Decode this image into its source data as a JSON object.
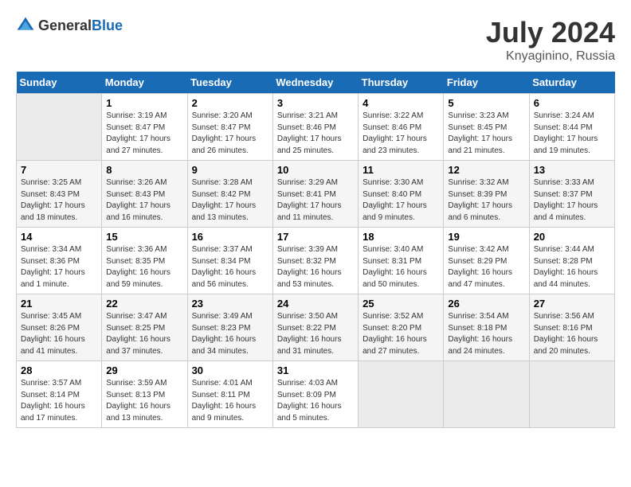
{
  "header": {
    "logo_general": "General",
    "logo_blue": "Blue",
    "month": "July 2024",
    "location": "Knyaginino, Russia"
  },
  "days_of_week": [
    "Sunday",
    "Monday",
    "Tuesday",
    "Wednesday",
    "Thursday",
    "Friday",
    "Saturday"
  ],
  "weeks": [
    [
      {
        "day": "",
        "sunrise": "",
        "sunset": "",
        "daylight": ""
      },
      {
        "day": "1",
        "sunrise": "Sunrise: 3:19 AM",
        "sunset": "Sunset: 8:47 PM",
        "daylight": "Daylight: 17 hours and 27 minutes."
      },
      {
        "day": "2",
        "sunrise": "Sunrise: 3:20 AM",
        "sunset": "Sunset: 8:47 PM",
        "daylight": "Daylight: 17 hours and 26 minutes."
      },
      {
        "day": "3",
        "sunrise": "Sunrise: 3:21 AM",
        "sunset": "Sunset: 8:46 PM",
        "daylight": "Daylight: 17 hours and 25 minutes."
      },
      {
        "day": "4",
        "sunrise": "Sunrise: 3:22 AM",
        "sunset": "Sunset: 8:46 PM",
        "daylight": "Daylight: 17 hours and 23 minutes."
      },
      {
        "day": "5",
        "sunrise": "Sunrise: 3:23 AM",
        "sunset": "Sunset: 8:45 PM",
        "daylight": "Daylight: 17 hours and 21 minutes."
      },
      {
        "day": "6",
        "sunrise": "Sunrise: 3:24 AM",
        "sunset": "Sunset: 8:44 PM",
        "daylight": "Daylight: 17 hours and 19 minutes."
      }
    ],
    [
      {
        "day": "7",
        "sunrise": "Sunrise: 3:25 AM",
        "sunset": "Sunset: 8:43 PM",
        "daylight": "Daylight: 17 hours and 18 minutes."
      },
      {
        "day": "8",
        "sunrise": "Sunrise: 3:26 AM",
        "sunset": "Sunset: 8:43 PM",
        "daylight": "Daylight: 17 hours and 16 minutes."
      },
      {
        "day": "9",
        "sunrise": "Sunrise: 3:28 AM",
        "sunset": "Sunset: 8:42 PM",
        "daylight": "Daylight: 17 hours and 13 minutes."
      },
      {
        "day": "10",
        "sunrise": "Sunrise: 3:29 AM",
        "sunset": "Sunset: 8:41 PM",
        "daylight": "Daylight: 17 hours and 11 minutes."
      },
      {
        "day": "11",
        "sunrise": "Sunrise: 3:30 AM",
        "sunset": "Sunset: 8:40 PM",
        "daylight": "Daylight: 17 hours and 9 minutes."
      },
      {
        "day": "12",
        "sunrise": "Sunrise: 3:32 AM",
        "sunset": "Sunset: 8:39 PM",
        "daylight": "Daylight: 17 hours and 6 minutes."
      },
      {
        "day": "13",
        "sunrise": "Sunrise: 3:33 AM",
        "sunset": "Sunset: 8:37 PM",
        "daylight": "Daylight: 17 hours and 4 minutes."
      }
    ],
    [
      {
        "day": "14",
        "sunrise": "Sunrise: 3:34 AM",
        "sunset": "Sunset: 8:36 PM",
        "daylight": "Daylight: 17 hours and 1 minute."
      },
      {
        "day": "15",
        "sunrise": "Sunrise: 3:36 AM",
        "sunset": "Sunset: 8:35 PM",
        "daylight": "Daylight: 16 hours and 59 minutes."
      },
      {
        "day": "16",
        "sunrise": "Sunrise: 3:37 AM",
        "sunset": "Sunset: 8:34 PM",
        "daylight": "Daylight: 16 hours and 56 minutes."
      },
      {
        "day": "17",
        "sunrise": "Sunrise: 3:39 AM",
        "sunset": "Sunset: 8:32 PM",
        "daylight": "Daylight: 16 hours and 53 minutes."
      },
      {
        "day": "18",
        "sunrise": "Sunrise: 3:40 AM",
        "sunset": "Sunset: 8:31 PM",
        "daylight": "Daylight: 16 hours and 50 minutes."
      },
      {
        "day": "19",
        "sunrise": "Sunrise: 3:42 AM",
        "sunset": "Sunset: 8:29 PM",
        "daylight": "Daylight: 16 hours and 47 minutes."
      },
      {
        "day": "20",
        "sunrise": "Sunrise: 3:44 AM",
        "sunset": "Sunset: 8:28 PM",
        "daylight": "Daylight: 16 hours and 44 minutes."
      }
    ],
    [
      {
        "day": "21",
        "sunrise": "Sunrise: 3:45 AM",
        "sunset": "Sunset: 8:26 PM",
        "daylight": "Daylight: 16 hours and 41 minutes."
      },
      {
        "day": "22",
        "sunrise": "Sunrise: 3:47 AM",
        "sunset": "Sunset: 8:25 PM",
        "daylight": "Daylight: 16 hours and 37 minutes."
      },
      {
        "day": "23",
        "sunrise": "Sunrise: 3:49 AM",
        "sunset": "Sunset: 8:23 PM",
        "daylight": "Daylight: 16 hours and 34 minutes."
      },
      {
        "day": "24",
        "sunrise": "Sunrise: 3:50 AM",
        "sunset": "Sunset: 8:22 PM",
        "daylight": "Daylight: 16 hours and 31 minutes."
      },
      {
        "day": "25",
        "sunrise": "Sunrise: 3:52 AM",
        "sunset": "Sunset: 8:20 PM",
        "daylight": "Daylight: 16 hours and 27 minutes."
      },
      {
        "day": "26",
        "sunrise": "Sunrise: 3:54 AM",
        "sunset": "Sunset: 8:18 PM",
        "daylight": "Daylight: 16 hours and 24 minutes."
      },
      {
        "day": "27",
        "sunrise": "Sunrise: 3:56 AM",
        "sunset": "Sunset: 8:16 PM",
        "daylight": "Daylight: 16 hours and 20 minutes."
      }
    ],
    [
      {
        "day": "28",
        "sunrise": "Sunrise: 3:57 AM",
        "sunset": "Sunset: 8:14 PM",
        "daylight": "Daylight: 16 hours and 17 minutes."
      },
      {
        "day": "29",
        "sunrise": "Sunrise: 3:59 AM",
        "sunset": "Sunset: 8:13 PM",
        "daylight": "Daylight: 16 hours and 13 minutes."
      },
      {
        "day": "30",
        "sunrise": "Sunrise: 4:01 AM",
        "sunset": "Sunset: 8:11 PM",
        "daylight": "Daylight: 16 hours and 9 minutes."
      },
      {
        "day": "31",
        "sunrise": "Sunrise: 4:03 AM",
        "sunset": "Sunset: 8:09 PM",
        "daylight": "Daylight: 16 hours and 5 minutes."
      },
      {
        "day": "",
        "sunrise": "",
        "sunset": "",
        "daylight": ""
      },
      {
        "day": "",
        "sunrise": "",
        "sunset": "",
        "daylight": ""
      },
      {
        "day": "",
        "sunrise": "",
        "sunset": "",
        "daylight": ""
      }
    ]
  ]
}
